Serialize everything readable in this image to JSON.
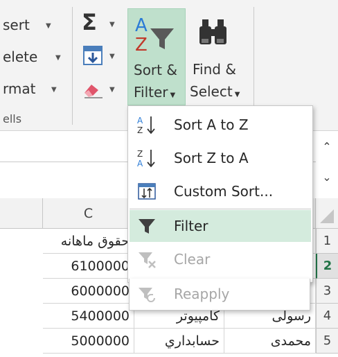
{
  "ribbon": {
    "cells_group": {
      "insert_label": "sert",
      "delete_label": "elete",
      "format_label": "rmat",
      "group_label": "ells"
    },
    "editing": {
      "sort_filter_line1": "Sort &",
      "sort_filter_line2": "Filter",
      "find_select_line1": "Find &",
      "find_select_line2": "Select",
      "sigma_glyph": "Σ",
      "az_glyph_a": "A",
      "az_glyph_z": "Z"
    }
  },
  "sort_menu": {
    "items": [
      {
        "label": "Sort A to Z",
        "icon": "sort-az-icon",
        "enabled": true
      },
      {
        "label": "Sort Z to A",
        "icon": "sort-za-icon",
        "enabled": true
      },
      {
        "label": "Custom Sort...",
        "icon": "custom-sort-icon",
        "enabled": true
      },
      {
        "label": "Filter",
        "icon": "filter-icon",
        "enabled": true,
        "selected": true
      },
      {
        "label": "Clear",
        "icon": "clear-filter-icon",
        "enabled": false
      },
      {
        "label": "Reapply",
        "icon": "reapply-icon",
        "enabled": false
      }
    ]
  },
  "scroll": {
    "up": "⌃",
    "down": "⌄"
  },
  "grid": {
    "column_c": "C",
    "rows": [
      {
        "row": "1",
        "c": "حقوق ماهانه",
        "d": "",
        "e": ""
      },
      {
        "row": "2",
        "c": "6100000",
        "d": "",
        "e": ""
      },
      {
        "row": "3",
        "c": "6000000",
        "d": "",
        "e": ""
      },
      {
        "row": "4",
        "c": "5400000",
        "d": "كامپيوتر",
        "e": "رسولی"
      },
      {
        "row": "5",
        "c": "5000000",
        "d": "حسابداري",
        "e": "محمدی"
      }
    ],
    "active_row": "2"
  },
  "colors": {
    "accent": "#217346",
    "selected_fill": "#d4ebdd",
    "button_active": "#bfe0cc"
  }
}
